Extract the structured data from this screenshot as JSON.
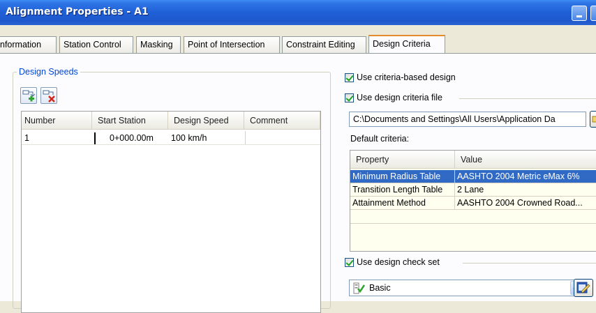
{
  "window": {
    "title": "Alignment Properties - A1"
  },
  "tabs": [
    {
      "label": "nformation"
    },
    {
      "label": "Station Control"
    },
    {
      "label": "Masking"
    },
    {
      "label": "Point of Intersection"
    },
    {
      "label": "Constraint Editing"
    },
    {
      "label": "Design Criteria"
    }
  ],
  "design_speeds": {
    "group_label": "Design Speeds",
    "add_icon": "add-row-icon",
    "delete_icon": "delete-row-icon",
    "columns": [
      "Number",
      "Start Station",
      "Design Speed",
      "Comment"
    ],
    "rows": [
      {
        "number": "1",
        "start_station": "0+000.00m",
        "design_speed": "100 km/h",
        "comment": ""
      }
    ]
  },
  "criteria": {
    "use_criteria_based_label": "Use criteria-based design",
    "use_criteria_file_label": "Use design criteria file",
    "file_path": "C:\\Documents and Settings\\All Users\\Application Da",
    "default_criteria_label": "Default criteria:",
    "columns": [
      "Property",
      "Value"
    ],
    "rows": [
      {
        "property": "Minimum Radius Table",
        "value": "AASHTO 2004 Metric eMax 6%"
      },
      {
        "property": "Transition Length Table",
        "value": "2 Lane"
      },
      {
        "property": "Attainment Method",
        "value": "AASHTO 2004 Crowned Road..."
      }
    ]
  },
  "check_set": {
    "use_check_set_label": "Use design check set",
    "selected": "Basic"
  },
  "colors": {
    "titlebar": "#1f5fd6",
    "selection": "#316ac5",
    "tab_highlight": "#e68b2c",
    "legend_text": "#0046d5"
  }
}
